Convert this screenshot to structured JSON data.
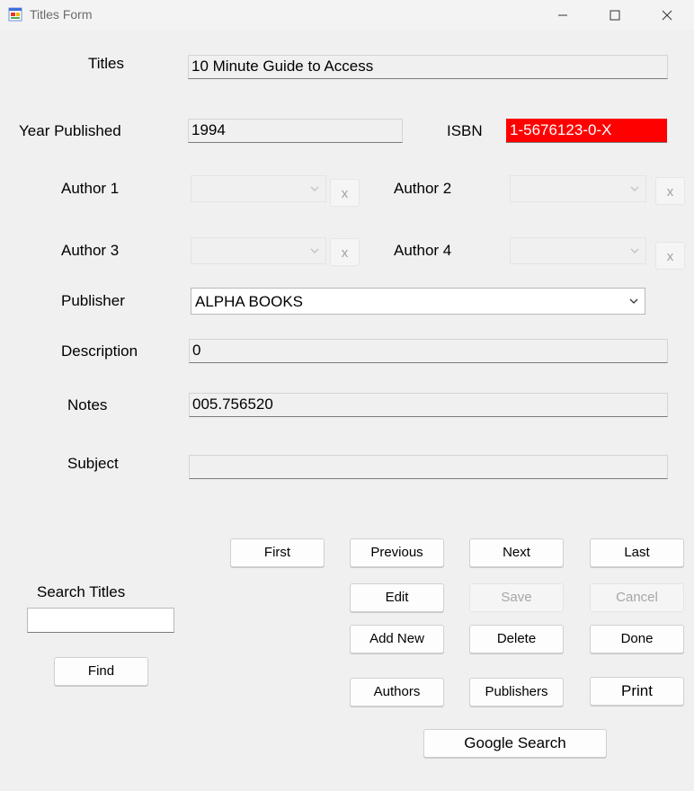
{
  "window": {
    "title": "Titles Form"
  },
  "labels": {
    "titles": "Titles",
    "year_published": "Year Published",
    "isbn": "ISBN",
    "author1": "Author 1",
    "author2": "Author 2",
    "author3": "Author 3",
    "author4": "Author 4",
    "publisher": "Publisher",
    "description": "Description",
    "notes": "Notes",
    "subject": "Subject",
    "search_titles": "Search Titles"
  },
  "fields": {
    "title": "10 Minute Guide to Access",
    "year_published": "1994",
    "isbn": "1-5676123-0-X",
    "publisher": "ALPHA BOOKS",
    "description": "0",
    "notes": "005.756520",
    "subject": "",
    "search": ""
  },
  "clear_button_label": "x",
  "buttons": {
    "first": "First",
    "previous": "Previous",
    "next": "Next",
    "last": "Last",
    "edit": "Edit",
    "save": "Save",
    "cancel": "Cancel",
    "add_new": "Add New",
    "delete": "Delete",
    "done": "Done",
    "find": "Find",
    "authors": "Authors",
    "publishers": "Publishers",
    "print": "Print",
    "google_search": "Google Search"
  },
  "colors": {
    "isbn_highlight": "#ff0000",
    "background": "#f0f0f0"
  }
}
